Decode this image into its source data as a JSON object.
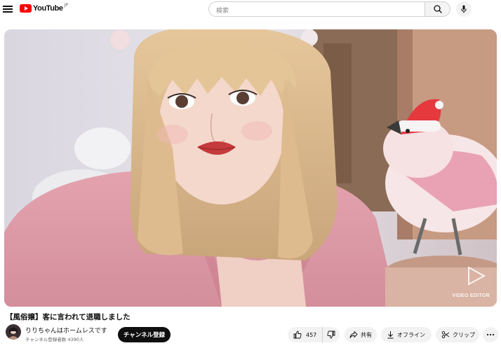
{
  "header": {
    "logo_text": "YouTube",
    "logo_sup": "JP",
    "search_placeholder": "検索",
    "icons": [
      "menu-icon",
      "search-icon",
      "mic-icon"
    ]
  },
  "video": {
    "watermark": "VIDEO EDITOR"
  },
  "title": "【風俗嬢】客に言われて退職しました",
  "channel": {
    "name": "りりちゃんはホームレスです",
    "subscribers": "チャンネル登録者数 4390人",
    "subscribe_label": "チャンネル登録"
  },
  "actions": {
    "likes": "457",
    "share": "共有",
    "offline": "オフライン",
    "clip": "クリップ"
  },
  "colors": {
    "brand_red": "#ff0000",
    "subscribe_bg": "#0f0f0f",
    "pill_bg": "#f2f2f2"
  }
}
